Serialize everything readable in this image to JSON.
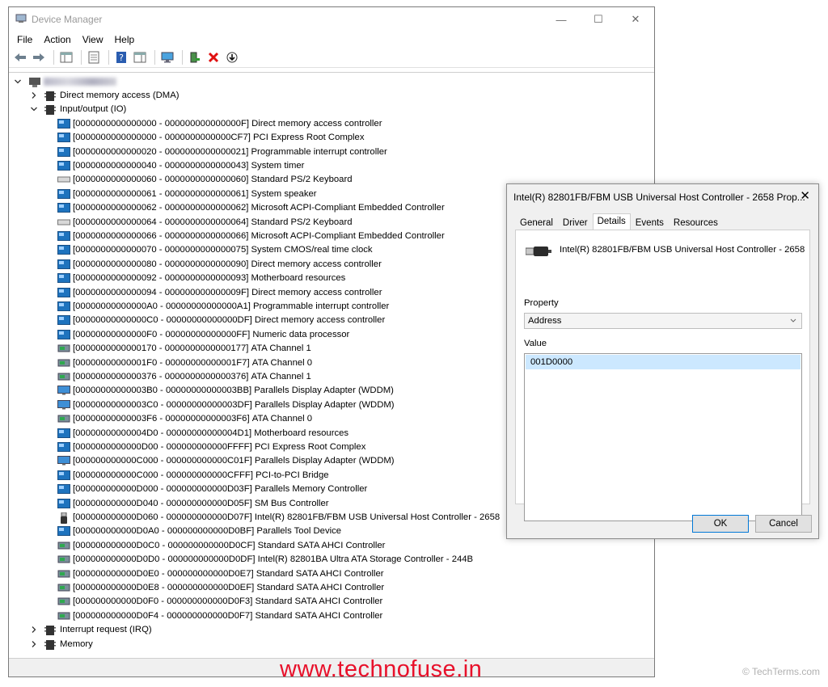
{
  "window": {
    "title": "Device Manager",
    "minimize": "—",
    "maximize": "☐",
    "close": "✕"
  },
  "menu": [
    "File",
    "Action",
    "View",
    "Help"
  ],
  "tree": {
    "top": [
      {
        "label": "Direct memory access (DMA)",
        "expanded": false,
        "icon": "chip-icon"
      },
      {
        "label": "Input/output (IO)",
        "expanded": true,
        "icon": "chip-icon"
      }
    ],
    "io_items": [
      {
        "range": "[0000000000000000 - 000000000000000F]",
        "name": "Direct memory access controller",
        "icon": "system"
      },
      {
        "range": "[0000000000000000 - 0000000000000CF7]",
        "name": "PCI Express Root Complex",
        "icon": "system"
      },
      {
        "range": "[0000000000000020 - 0000000000000021]",
        "name": "Programmable interrupt controller",
        "icon": "system"
      },
      {
        "range": "[0000000000000040 - 0000000000000043]",
        "name": "System timer",
        "icon": "system"
      },
      {
        "range": "[0000000000000060 - 0000000000000060]",
        "name": "Standard PS/2 Keyboard",
        "icon": "keyboard"
      },
      {
        "range": "[0000000000000061 - 0000000000000061]",
        "name": "System speaker",
        "icon": "system"
      },
      {
        "range": "[0000000000000062 - 0000000000000062]",
        "name": "Microsoft ACPI-Compliant Embedded Controller",
        "icon": "system"
      },
      {
        "range": "[0000000000000064 - 0000000000000064]",
        "name": "Standard PS/2 Keyboard",
        "icon": "keyboard"
      },
      {
        "range": "[0000000000000066 - 0000000000000066]",
        "name": "Microsoft ACPI-Compliant Embedded Controller",
        "icon": "system"
      },
      {
        "range": "[0000000000000070 - 0000000000000075]",
        "name": "System CMOS/real time clock",
        "icon": "system"
      },
      {
        "range": "[0000000000000080 - 0000000000000090]",
        "name": "Direct memory access controller",
        "icon": "system"
      },
      {
        "range": "[0000000000000092 - 0000000000000093]",
        "name": "Motherboard resources",
        "icon": "system"
      },
      {
        "range": "[0000000000000094 - 000000000000009F]",
        "name": "Direct memory access controller",
        "icon": "system"
      },
      {
        "range": "[00000000000000A0 - 00000000000000A1]",
        "name": "Programmable interrupt controller",
        "icon": "system"
      },
      {
        "range": "[00000000000000C0 - 00000000000000DF]",
        "name": "Direct memory access controller",
        "icon": "system"
      },
      {
        "range": "[00000000000000F0 - 00000000000000FF]",
        "name": "Numeric data processor",
        "icon": "system"
      },
      {
        "range": "[0000000000000170 - 0000000000000177]",
        "name": "ATA Channel 1",
        "icon": "storage"
      },
      {
        "range": "[00000000000001F0 - 00000000000001F7]",
        "name": "ATA Channel 0",
        "icon": "storage"
      },
      {
        "range": "[0000000000000376 - 0000000000000376]",
        "name": "ATA Channel 1",
        "icon": "storage"
      },
      {
        "range": "[00000000000003B0 - 00000000000003BB]",
        "name": "Parallels Display Adapter (WDDM)",
        "icon": "display"
      },
      {
        "range": "[00000000000003C0 - 00000000000003DF]",
        "name": "Parallels Display Adapter (WDDM)",
        "icon": "display"
      },
      {
        "range": "[00000000000003F6 - 00000000000003F6]",
        "name": "ATA Channel 0",
        "icon": "storage"
      },
      {
        "range": "[00000000000004D0 - 00000000000004D1]",
        "name": "Motherboard resources",
        "icon": "system"
      },
      {
        "range": "[0000000000000D00 - 000000000000FFFF]",
        "name": "PCI Express Root Complex",
        "icon": "system"
      },
      {
        "range": "[000000000000C000 - 000000000000C01F]",
        "name": "Parallels Display Adapter (WDDM)",
        "icon": "display"
      },
      {
        "range": "[000000000000C000 - 000000000000CFFF]",
        "name": "PCI-to-PCI Bridge",
        "icon": "system"
      },
      {
        "range": "[000000000000D000 - 000000000000D03F]",
        "name": "Parallels Memory Controller",
        "icon": "system"
      },
      {
        "range": "[000000000000D040 - 000000000000D05F]",
        "name": "SM Bus Controller",
        "icon": "system"
      },
      {
        "range": "[000000000000D060 - 000000000000D07F]",
        "name": "Intel(R) 82801FB/FBM USB Universal Host Controller - 2658",
        "icon": "usb"
      },
      {
        "range": "[000000000000D0A0 - 000000000000D0BF]",
        "name": "Parallels Tool Device",
        "icon": "system"
      },
      {
        "range": "[000000000000D0C0 - 000000000000D0CF]",
        "name": "Standard SATA AHCI Controller",
        "icon": "storage"
      },
      {
        "range": "[000000000000D0D0 - 000000000000D0DF]",
        "name": "Intel(R) 82801BA Ultra ATA Storage Controller - 244B",
        "icon": "storage"
      },
      {
        "range": "[000000000000D0E0 - 000000000000D0E7]",
        "name": "Standard SATA AHCI Controller",
        "icon": "storage"
      },
      {
        "range": "[000000000000D0E8 - 000000000000D0EF]",
        "name": "Standard SATA AHCI Controller",
        "icon": "storage"
      },
      {
        "range": "[000000000000D0F0 - 000000000000D0F3]",
        "name": "Standard SATA AHCI Controller",
        "icon": "storage"
      },
      {
        "range": "[000000000000D0F4 - 000000000000D0F7]",
        "name": "Standard SATA AHCI Controller",
        "icon": "storage"
      }
    ],
    "bottom": [
      {
        "label": "Interrupt request (IRQ)",
        "expanded": false,
        "icon": "chip-icon"
      },
      {
        "label": "Memory",
        "expanded": false,
        "icon": "chip-icon"
      }
    ]
  },
  "dialog": {
    "title": "Intel(R) 82801FB/FBM USB Universal Host Controller - 2658 Prop...",
    "close": "✕",
    "tabs": [
      "General",
      "Driver",
      "Details",
      "Events",
      "Resources"
    ],
    "active_tab": "Details",
    "device_name": "Intel(R) 82801FB/FBM USB Universal Host Controller - 2658",
    "property_label": "Property",
    "property_value": "Address",
    "value_label": "Value",
    "value_selected": "001D0000",
    "ok": "OK",
    "cancel": "Cancel"
  },
  "overlay": {
    "watermark": "www.technofuse.in",
    "credit": "© TechTerms.com"
  },
  "colors": {
    "accent": "#0078d7",
    "selection": "#cce8ff",
    "watermark": "#e8102a",
    "system_icon": "#1e73be"
  }
}
